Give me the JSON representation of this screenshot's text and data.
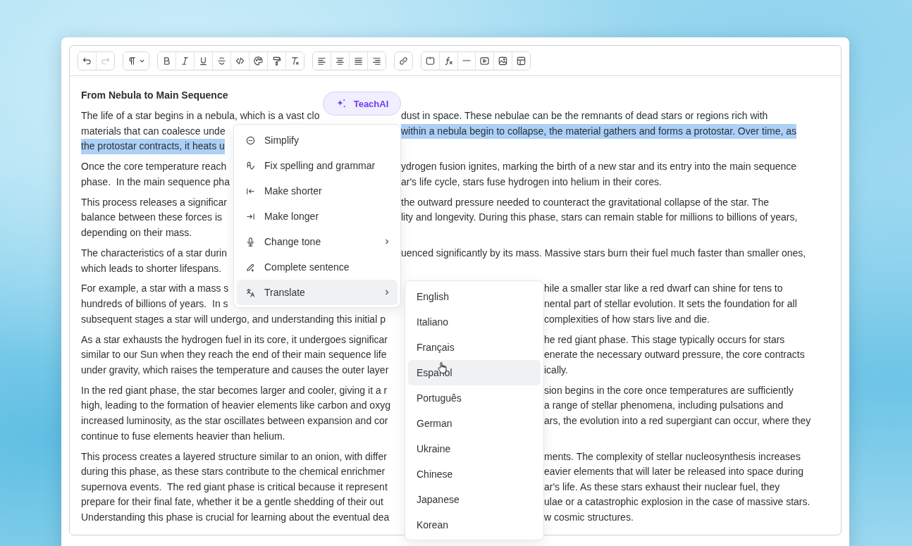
{
  "toolbar": {
    "groups": [
      [
        {
          "kind": "undo",
          "disabled": false
        },
        {
          "kind": "redo",
          "disabled": true
        }
      ],
      [
        {
          "kind": "paragraph",
          "disabled": false
        }
      ],
      [
        {
          "kind": "bold",
          "disabled": false
        },
        {
          "kind": "italic",
          "disabled": false
        },
        {
          "kind": "underline",
          "disabled": false
        },
        {
          "kind": "strike",
          "disabled": false
        },
        {
          "kind": "code",
          "disabled": false
        },
        {
          "kind": "palette",
          "disabled": false
        },
        {
          "kind": "roller",
          "disabled": false
        },
        {
          "kind": "clear",
          "disabled": false
        }
      ],
      [
        {
          "kind": "align-left",
          "disabled": false
        },
        {
          "kind": "align-center",
          "disabled": false
        },
        {
          "kind": "justify",
          "disabled": false
        },
        {
          "kind": "align-right",
          "disabled": false
        }
      ],
      [
        {
          "kind": "link",
          "disabled": false
        }
      ],
      [
        {
          "kind": "frame",
          "disabled": false
        },
        {
          "kind": "formula",
          "disabled": false
        },
        {
          "kind": "rule",
          "disabled": false
        },
        {
          "kind": "video",
          "disabled": false
        },
        {
          "kind": "image",
          "disabled": false
        },
        {
          "kind": "table",
          "disabled": false
        }
      ]
    ]
  },
  "editor": {
    "heading": "From Nebula to Main Sequence",
    "paragraphs": [
      {
        "lines": [
          {
            "segments": [
              {
                "text": "The life of a star begins in a nebula, which is a vast clo",
                "selected": false
              },
              {
                "text": "dust in space. These nebulae can be the remnants of dead stars or regions rich with",
                "selected": false
              }
            ]
          },
          {
            "segments": [
              {
                "text": "materials that can coalesce unde",
                "selected": false
              },
              {
                "text": "within a nebula begin to collapse, the material gathers and forms a protostar. Over time, as",
                "selected": true
              }
            ]
          },
          {
            "segments": [
              {
                "text": "the protostar contracts, it heats u",
                "selected": true
              }
            ]
          }
        ]
      },
      {
        "lines": [
          {
            "segments": [
              {
                "text": "Once the core temperature reach",
                "selected": false
              },
              {
                "text": "ydrogen fusion ignites, marking the birth of a new star and its entry into the main sequence",
                "selected": false
              }
            ]
          },
          {
            "segments": [
              {
                "text": "phase.  In the main sequence pha",
                "selected": false
              },
              {
                "text": "ar's life cycle, stars fuse hydrogen into helium in their cores.",
                "selected": false
              }
            ]
          }
        ]
      },
      {
        "lines": [
          {
            "segments": [
              {
                "text": "This process releases a significar",
                "selected": false
              },
              {
                "text": "the outward pressure needed to counteract the gravitational collapse of the star. The",
                "selected": false
              }
            ]
          },
          {
            "segments": [
              {
                "text": "balance between these forces is",
                "selected": false
              },
              {
                "text": "lity and longevity. During this phase, stars can remain stable for millions to billions of years,",
                "selected": false
              }
            ]
          },
          {
            "segments": [
              {
                "text": "depending on their mass.",
                "selected": false
              }
            ]
          }
        ]
      },
      {
        "lines": [
          {
            "segments": [
              {
                "text": "The characteristics of a star durin",
                "selected": false
              },
              {
                "text": "uenced significantly by its mass. Massive stars burn their fuel much faster than smaller ones,",
                "selected": false
              }
            ]
          },
          {
            "segments": [
              {
                "text": "which leads to shorter lifespans.",
                "selected": false
              }
            ]
          }
        ]
      },
      {
        "lines": [
          {
            "segments": [
              {
                "text": "For example, a star with a mass s",
                "selected": false
              },
              {
                "text": "hile a smaller star like a red dwarf can shine for tens to",
                "selected": false
              }
            ]
          },
          {
            "segments": [
              {
                "text": "hundreds of billions of years.  In s",
                "selected": false
              },
              {
                "text": "nental part of stellar evolution. It sets the foundation for all",
                "selected": false
              }
            ]
          },
          {
            "segments": [
              {
                "text": "subsequent stages a star will undergo, and understanding this initial p",
                "selected": false
              },
              {
                "text": "complexities of how stars live and die.",
                "selected": false
              }
            ]
          }
        ]
      },
      {
        "lines": [
          {
            "segments": [
              {
                "text": "As a star exhausts the hydrogen fuel in its core, it undergoes significar",
                "selected": false
              },
              {
                "text": "he red giant phase. This stage typically occurs for stars",
                "selected": false
              }
            ]
          },
          {
            "segments": [
              {
                "text": "similar to our Sun when they reach the end of their main sequence life",
                "selected": false
              },
              {
                "text": "enerate the necessary outward pressure, the core contracts",
                "selected": false
              }
            ]
          },
          {
            "segments": [
              {
                "text": "under gravity, which raises the temperature and causes the outer layer",
                "selected": false
              },
              {
                "text": "ically.",
                "selected": false
              }
            ]
          }
        ]
      },
      {
        "lines": [
          {
            "segments": [
              {
                "text": "In the red giant phase, the star becomes larger and cooler, giving it a r",
                "selected": false
              },
              {
                "text": "sion begins in the core once temperatures are sufficiently",
                "selected": false
              }
            ]
          },
          {
            "segments": [
              {
                "text": "high, leading to the formation of heavier elements like carbon and oxyg",
                "selected": false
              },
              {
                "text": "a range of stellar phenomena, including pulsations and",
                "selected": false
              }
            ]
          },
          {
            "segments": [
              {
                "text": "increased luminosity, as the star oscillates between expansion and cor",
                "selected": false
              },
              {
                "text": "ars, the evolution into a red supergiant can occur, where they",
                "selected": false
              }
            ]
          },
          {
            "segments": [
              {
                "text": "continue to fuse elements heavier than helium.",
                "selected": false
              }
            ]
          }
        ]
      },
      {
        "lines": [
          {
            "segments": [
              {
                "text": "This process creates a layered structure similar to an onion, with differ",
                "selected": false
              },
              {
                "text": "ments. The complexity of stellar nucleosynthesis increases",
                "selected": false
              }
            ]
          },
          {
            "segments": [
              {
                "text": "during this phase, as these stars contribute to the chemical enrichmer",
                "selected": false
              },
              {
                "text": "eavier elements that will later be released into space during",
                "selected": false
              }
            ]
          },
          {
            "segments": [
              {
                "text": "supernova events.  The red giant phase is critical because it represent",
                "selected": false
              },
              {
                "text": "ar's life. As these stars exhaust their nuclear fuel, they",
                "selected": false
              }
            ]
          },
          {
            "segments": [
              {
                "text": "prepare for their final fate, whether it be a gentle shedding of their out",
                "selected": false
              },
              {
                "text": "ulae or a catastrophic explosion in the case of massive stars.",
                "selected": false
              }
            ]
          },
          {
            "segments": [
              {
                "text": "Understanding this phase is crucial for learning about the eventual dea",
                "selected": false
              },
              {
                "text": "w cosmic structures.",
                "selected": false
              }
            ]
          }
        ]
      }
    ]
  },
  "ai_button": {
    "label": "TeachAI"
  },
  "ai_menu": {
    "items": [
      {
        "kind": "simplify",
        "label": "Simplify",
        "submenu": false,
        "selected": false
      },
      {
        "kind": "spelling",
        "label": "Fix spelling and grammar",
        "submenu": false,
        "selected": false
      },
      {
        "kind": "shorter",
        "label": "Make shorter",
        "submenu": false,
        "selected": false
      },
      {
        "kind": "longer",
        "label": "Make longer",
        "submenu": false,
        "selected": false
      },
      {
        "kind": "tone",
        "label": "Change tone",
        "submenu": true,
        "selected": false
      },
      {
        "kind": "complete",
        "label": "Complete sentence",
        "submenu": false,
        "selected": false
      },
      {
        "kind": "translate",
        "label": "Translate",
        "submenu": true,
        "selected": true
      }
    ]
  },
  "language_menu": {
    "items": [
      {
        "label": "English",
        "selected": false
      },
      {
        "label": "Italiano",
        "selected": false
      },
      {
        "label": "Français",
        "selected": false
      },
      {
        "label": "Español",
        "selected": true
      },
      {
        "label": "Português",
        "selected": false
      },
      {
        "label": "German",
        "selected": false
      },
      {
        "label": "Ukraine",
        "selected": false
      },
      {
        "label": "Chinese",
        "selected": false
      },
      {
        "label": "Japanese",
        "selected": false
      },
      {
        "label": "Korean",
        "selected": false
      }
    ]
  }
}
